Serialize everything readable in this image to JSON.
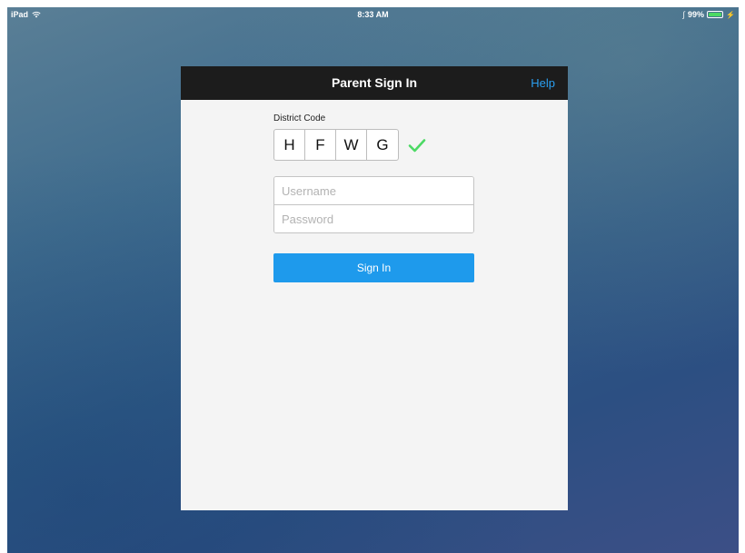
{
  "statusbar": {
    "device": "iPad",
    "time": "8:33 AM",
    "battery": "99%",
    "battery_level": 0.99,
    "icons": [
      "wifi-icon",
      "bluetooth-icon",
      "battery-icon",
      "charging-icon"
    ]
  },
  "header": {
    "title": "Parent Sign In",
    "help": "Help"
  },
  "form": {
    "district_label": "District Code",
    "district_code": [
      "H",
      "F",
      "W",
      "G"
    ],
    "district_valid_icon": "checkmark-icon",
    "username_placeholder": "Username",
    "password_placeholder": "Password",
    "signin_label": "Sign In"
  },
  "colors": {
    "header_bg": "#1c1c1c",
    "help_link": "#2a9ff0",
    "button_bg": "#1e9aec",
    "checkmark": "#4cd964",
    "panel_bg": "#f4f4f4"
  }
}
